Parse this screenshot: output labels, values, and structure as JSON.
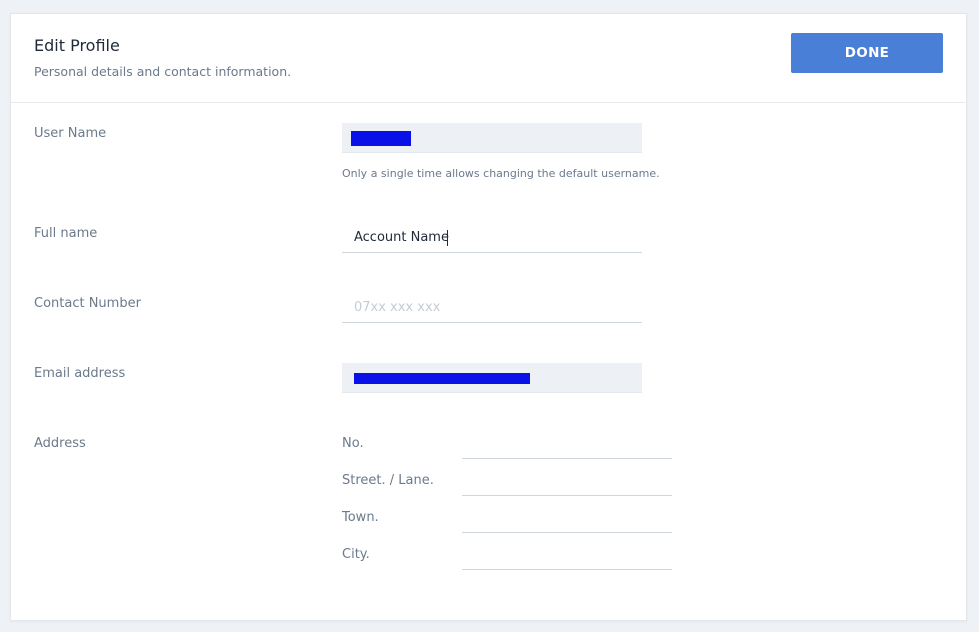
{
  "header": {
    "title": "Edit Profile",
    "subtitle": "Personal details and contact information.",
    "done_label": "DONE"
  },
  "form": {
    "username": {
      "label": "User Name",
      "value": "",
      "hint": "Only a single time allows changing the default username."
    },
    "full_name": {
      "label": "Full name",
      "value": "Account Name"
    },
    "contact": {
      "label": "Contact Number",
      "placeholder": "07xx xxx xxx",
      "value": ""
    },
    "email": {
      "label": "Email address",
      "value": ""
    },
    "address": {
      "label": "Address",
      "fields": [
        {
          "label": "No.",
          "value": ""
        },
        {
          "label": "Street. / Lane.",
          "value": ""
        },
        {
          "label": "Town.",
          "value": ""
        },
        {
          "label": "City.",
          "value": ""
        }
      ]
    }
  },
  "colors": {
    "accent": "#4a7fd8",
    "redaction": "#0a10e8",
    "readonly_bg": "#edf1f5"
  }
}
